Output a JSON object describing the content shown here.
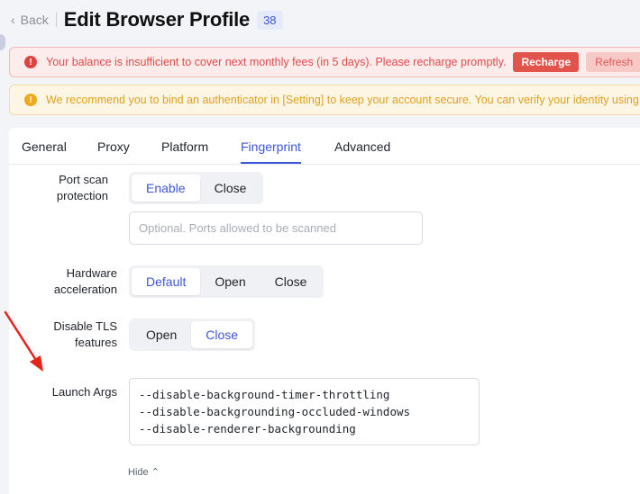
{
  "header": {
    "back_label": "Back",
    "title": "Edit Browser Profile",
    "badge": "38"
  },
  "alerts": {
    "balance": {
      "text": "Your balance is insufficient to cover next monthly fees (in 5 days). Please recharge promptly.",
      "recharge_label": "Recharge",
      "refresh_label": "Refresh"
    },
    "security": {
      "text": "We recommend you to bind an authenticator in [Setting] to keep your account secure. You can verify your identity using"
    }
  },
  "tabs": [
    {
      "label": "General"
    },
    {
      "label": "Proxy"
    },
    {
      "label": "Platform"
    },
    {
      "label": "Fingerprint",
      "active": true
    },
    {
      "label": "Advanced"
    }
  ],
  "form": {
    "port_scan": {
      "label_line1": "Port scan",
      "label_line2": "protection",
      "options": [
        "Enable",
        "Close"
      ],
      "selected": "Enable",
      "ports_placeholder": "Optional. Ports allowed to be scanned"
    },
    "hardware_accel": {
      "label_line1": "Hardware",
      "label_line2": "acceleration",
      "options": [
        "Default",
        "Open",
        "Close"
      ],
      "selected": "Default"
    },
    "disable_tls": {
      "label_line1": "Disable TLS",
      "label_line2": "features",
      "options": [
        "Open",
        "Close"
      ],
      "selected": "Close"
    },
    "launch_args": {
      "label": "Launch Args",
      "value": "--disable-background-timer-throttling\n--disable-backgrounding-occluded-windows\n--disable-renderer-backgrounding"
    },
    "hide_label": "Hide"
  },
  "colors": {
    "accent": "#3d56d8",
    "error": "#e04a4a",
    "warning": "#f0a91a",
    "annotation_arrow": "#e8231a"
  }
}
